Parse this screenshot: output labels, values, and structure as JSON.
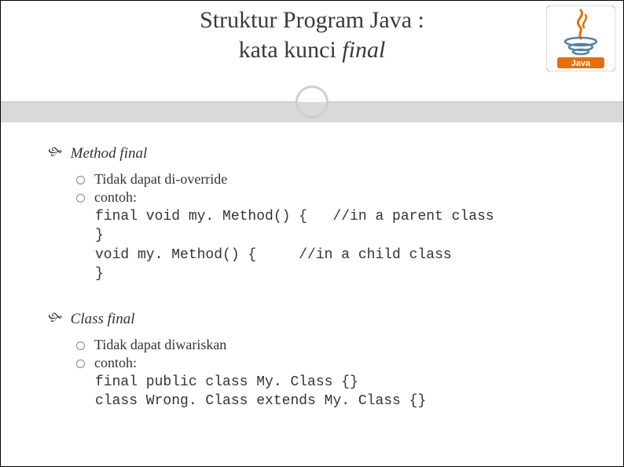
{
  "title": {
    "line1": "Struktur Program Java :",
    "line2_prefix": "kata kunci ",
    "line2_italic": "final"
  },
  "logo": {
    "label": "Java"
  },
  "sections": [
    {
      "heading": "Method final",
      "items": [
        {
          "text": "Tidak dapat di-override"
        },
        {
          "text": "contoh:",
          "code": "final void my. Method() {   //in a parent class\n}\nvoid my. Method() {     //in a child class\n}"
        }
      ]
    },
    {
      "heading": "Class final",
      "items": [
        {
          "text": "Tidak dapat diwariskan"
        },
        {
          "text": "contoh:",
          "code": "final public class My. Class {}\nclass Wrong. Class extends My. Class {}"
        }
      ]
    }
  ]
}
